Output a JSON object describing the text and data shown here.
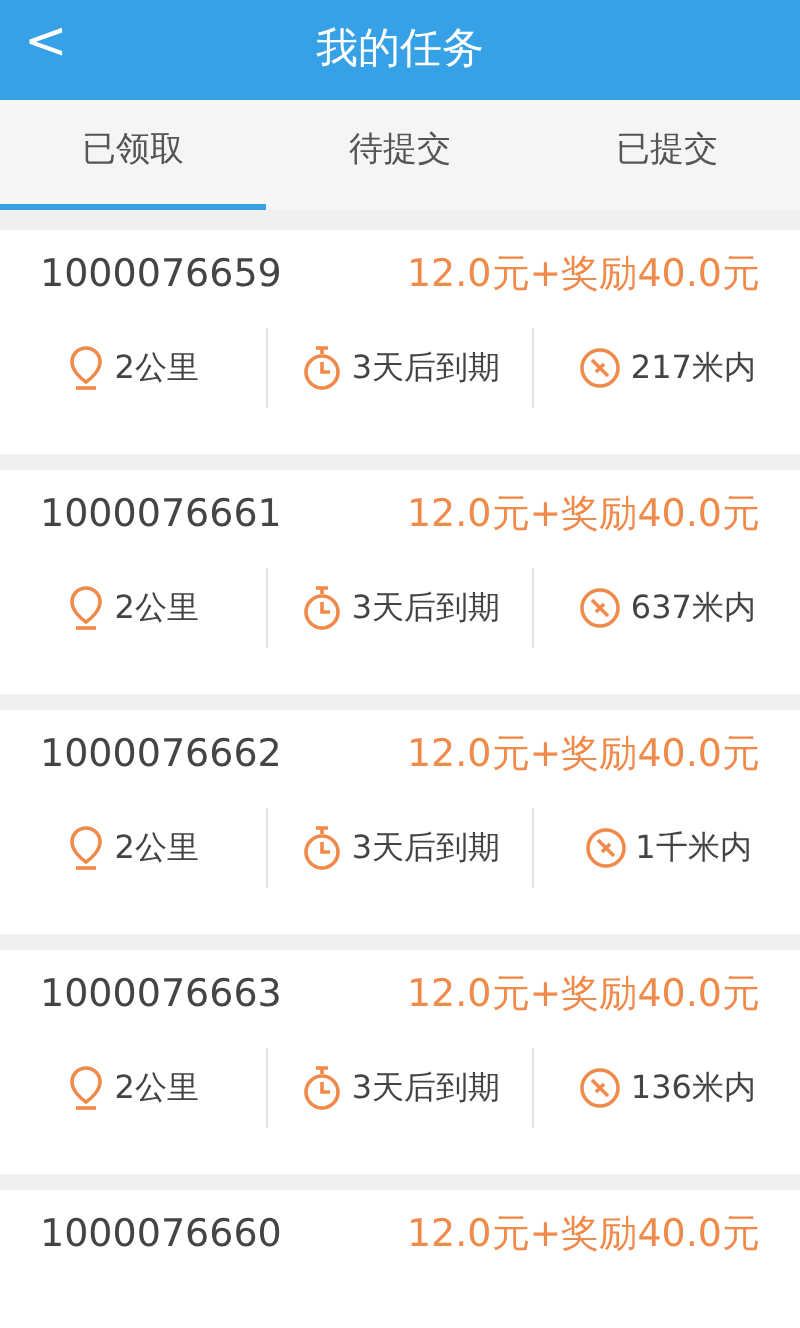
{
  "header": {
    "back": "<",
    "title": "我的任务"
  },
  "tabs": [
    {
      "label": "已领取",
      "selected": true
    },
    {
      "label": "待提交",
      "selected": false
    },
    {
      "label": "已提交",
      "selected": false
    }
  ],
  "tasks": [
    {
      "id": "1000076659",
      "reward": "12.0元+奖励40.0元",
      "distance": "2公里",
      "deadline": "3天后到期",
      "range": "217米内"
    },
    {
      "id": "1000076661",
      "reward": "12.0元+奖励40.0元",
      "distance": "2公里",
      "deadline": "3天后到期",
      "range": "637米内"
    },
    {
      "id": "1000076662",
      "reward": "12.0元+奖励40.0元",
      "distance": "2公里",
      "deadline": "3天后到期",
      "range": "1千米内"
    },
    {
      "id": "1000076663",
      "reward": "12.0元+奖励40.0元",
      "distance": "2公里",
      "deadline": "3天后到期",
      "range": "136米内"
    },
    {
      "id": "1000076660",
      "reward": "12.0元+奖励40.0元"
    }
  ]
}
